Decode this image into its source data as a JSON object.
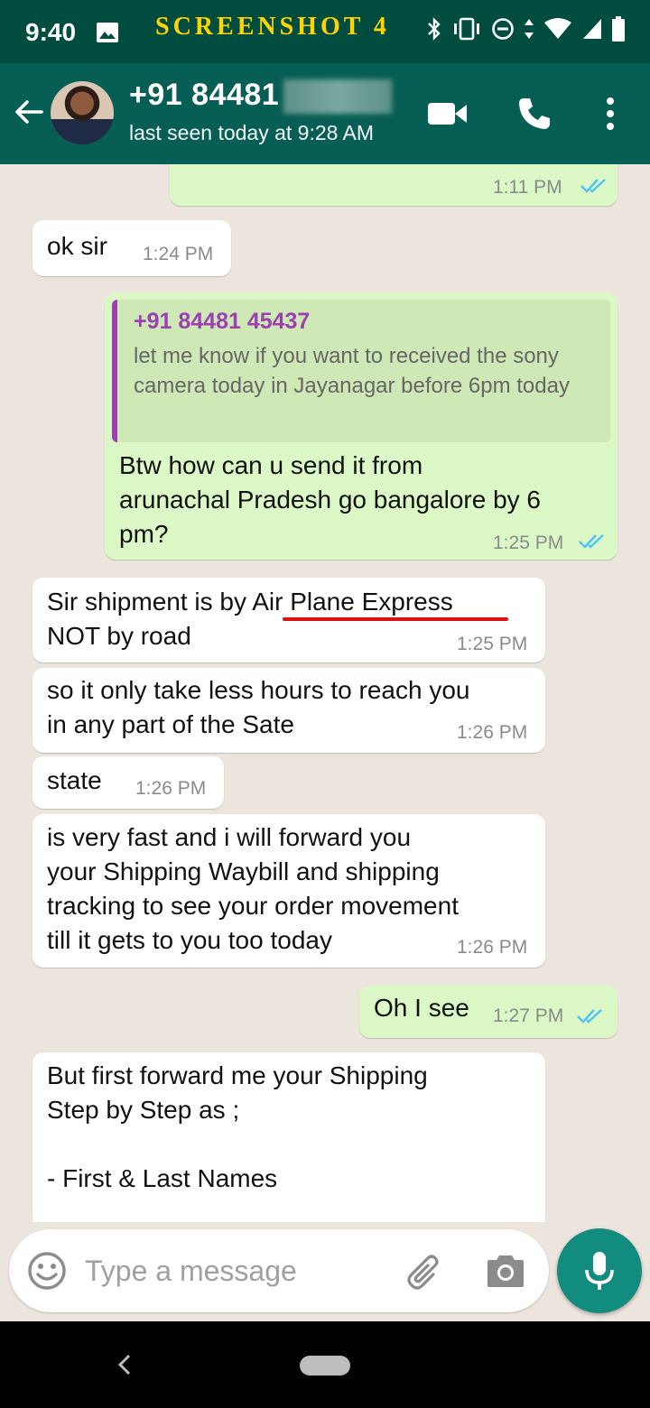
{
  "status_bar": {
    "time": "9:40",
    "banner": "SCREENSHOT 4"
  },
  "header": {
    "contact_name": "+91 84481",
    "last_seen": "last seen today at 9:28 AM"
  },
  "messages": [
    {
      "direction": "out",
      "text": "",
      "time": "1:11 PM",
      "read": true
    },
    {
      "direction": "in",
      "text": "ok sir",
      "time": "1:24 PM"
    },
    {
      "direction": "out",
      "quote": {
        "author": "+91 84481 45437",
        "text": "let me know if you want to received the sony camera today in Jayanagar before 6pm today"
      },
      "text": "Btw how can u send it from\narunachal Pradesh go bangalore by 6\npm?",
      "time": "1:25 PM",
      "read": true
    },
    {
      "direction": "in",
      "text": "Sir shipment is by Air Plane Express\nNOT by road",
      "time": "1:25 PM",
      "underlined_phrase": "Air Plane Express"
    },
    {
      "direction": "in",
      "text": "so it only take less hours to reach you\nin any part of the Sate",
      "time": "1:26 PM"
    },
    {
      "direction": "in",
      "text": "state",
      "time": "1:26 PM"
    },
    {
      "direction": "in",
      "text": "is very fast and i will forward you\nyour Shipping Waybill and shipping\ntracking to see your order movement\ntill it gets to you too today",
      "time": "1:26 PM"
    },
    {
      "direction": "out",
      "text": "Oh I see",
      "time": "1:27 PM",
      "read": true
    },
    {
      "direction": "in",
      "text": "But first forward me your Shipping\nStep by Step as ;\n\n- First & Last Names",
      "time": ""
    }
  ],
  "input": {
    "placeholder": "Type a message",
    "value": ""
  },
  "colors": {
    "header": "#075e54",
    "status_bar": "#004d40",
    "outgoing_bubble": "#dcf8c6",
    "incoming_bubble": "#ffffff",
    "chat_background": "#ece5dd",
    "read_ticks": "#4fc3f7",
    "quote_accent": "#9c3fb3",
    "underline": "#e01010",
    "fab": "#128c7e",
    "banner": "#ffd400"
  },
  "icons": [
    "back-arrow-icon",
    "video-call-icon",
    "voice-call-icon",
    "more-options-icon",
    "emoji-icon",
    "attach-icon",
    "camera-icon",
    "mic-icon"
  ]
}
